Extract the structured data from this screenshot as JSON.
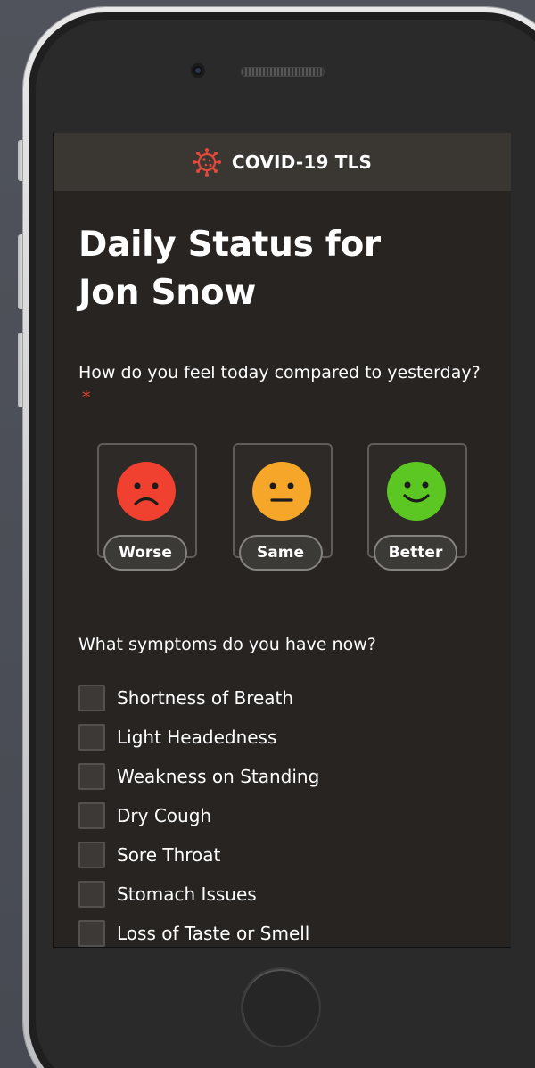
{
  "app": {
    "title": "COVID-19 TLS",
    "logo_icon": "virus-icon",
    "logo_color": "#e2493a"
  },
  "page": {
    "title_line1": "Daily Status for",
    "title_line2": "Jon Snow"
  },
  "feeling": {
    "question": "How do you feel today compared to yesterday?",
    "required_marker": "*",
    "options": [
      {
        "label": "Worse",
        "icon": "sad-face-icon",
        "color": "#f0402f"
      },
      {
        "label": "Same",
        "icon": "neutral-face-icon",
        "color": "#f6a628"
      },
      {
        "label": "Better",
        "icon": "happy-face-icon",
        "color": "#5cc623"
      }
    ]
  },
  "symptoms": {
    "question": "What symptoms do you have now?",
    "items": [
      {
        "label": "Shortness of Breath",
        "checked": false
      },
      {
        "label": "Light Headedness",
        "checked": false
      },
      {
        "label": "Weakness on Standing",
        "checked": false
      },
      {
        "label": "Dry Cough",
        "checked": false
      },
      {
        "label": "Sore Throat",
        "checked": false
      },
      {
        "label": "Stomach Issues",
        "checked": false
      },
      {
        "label": "Loss of Taste or Smell",
        "checked": false
      }
    ]
  }
}
